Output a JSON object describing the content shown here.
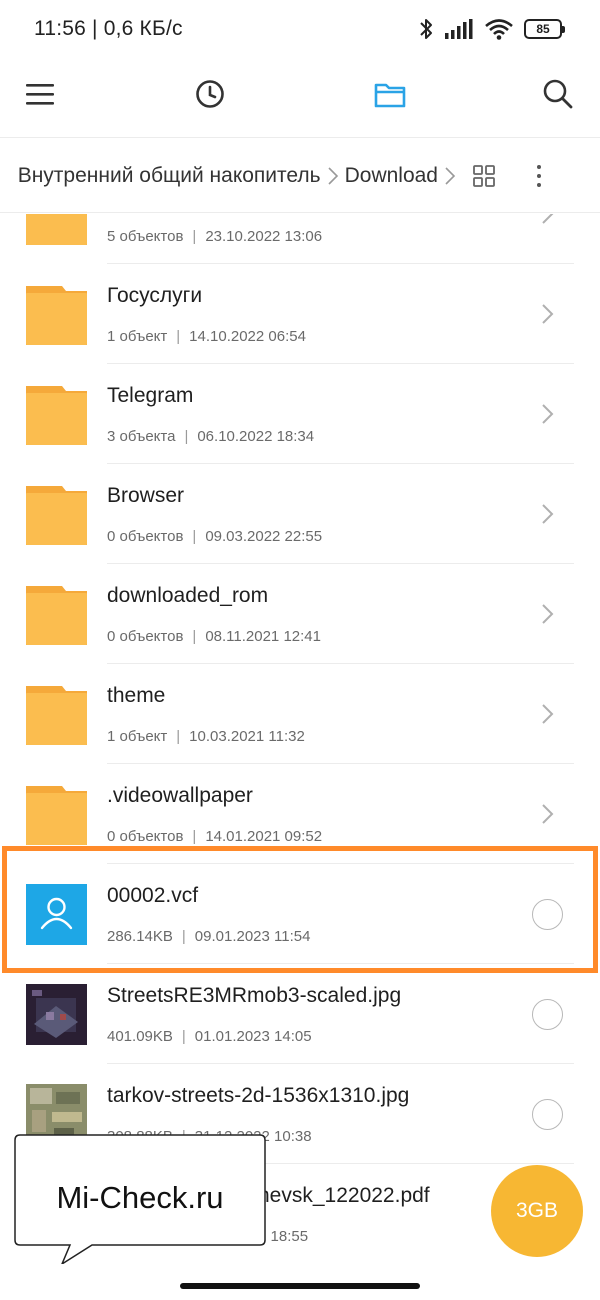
{
  "status_bar": {
    "time": "11:56 | 0,6 КБ/с",
    "battery": "85",
    "icons": [
      "bluetooth-icon",
      "signal-icon",
      "wifi-icon",
      "battery-icon"
    ]
  },
  "toolbar": {
    "icons": [
      "menu-icon",
      "recent-icon",
      "folder-icon",
      "search-icon"
    ],
    "active_color": "#2aa3e6"
  },
  "breadcrumb": {
    "items": [
      {
        "label": "Внутренний общий накопитель"
      },
      {
        "label": "Download"
      }
    ],
    "icons": [
      "grid-view-icon",
      "more-icon"
    ]
  },
  "files": [
    {
      "name": "",
      "meta_count": "5 объектов",
      "meta_date": "23.10.2022 13:06",
      "type": "folder"
    },
    {
      "name": "Госуслуги",
      "meta_count": "1 объект",
      "meta_date": "14.10.2022 06:54",
      "type": "folder"
    },
    {
      "name": "Telegram",
      "meta_count": "3 объекта",
      "meta_date": "06.10.2022 18:34",
      "type": "folder"
    },
    {
      "name": "Browser",
      "meta_count": "0 объектов",
      "meta_date": "09.03.2022 22:55",
      "type": "folder"
    },
    {
      "name": "downloaded_rom",
      "meta_count": "0 объектов",
      "meta_date": "08.11.2021 12:41",
      "type": "folder"
    },
    {
      "name": "theme",
      "meta_count": "1 объект",
      "meta_date": "10.03.2021 11:32",
      "type": "folder"
    },
    {
      "name": ".videowallpaper",
      "meta_count": "0 объектов",
      "meta_date": "14.01.2021 09:52",
      "type": "folder"
    },
    {
      "name": "00002.vcf",
      "meta_count": "286.14KB",
      "meta_date": "09.01.2023 11:54",
      "type": "contact"
    },
    {
      "name": "StreetsRE3MRmob3-scaled.jpg",
      "meta_count": "401.09KB",
      "meta_date": "01.01.2023 14:05",
      "type": "image"
    },
    {
      "name": "tarkov-streets-2d-1536x1310.jpg",
      "meta_count": "308.88KB",
      "meta_date": "31.12.2022 10:38",
      "type": "image"
    },
    {
      "name": "nevsk_122022.pdf",
      "meta_count": "",
      "meta_date": "2 18:55",
      "type": "pdf"
    }
  ],
  "storage_button": {
    "label": "3GB",
    "color": "#f7b733"
  },
  "watermark": {
    "text": "Mi-Check.ru"
  },
  "colors": {
    "folder": "#fbbd4f",
    "folder_tab": "#f5a93a",
    "contact_tile": "#1ea7e6",
    "highlight": "#ff8a2a"
  }
}
